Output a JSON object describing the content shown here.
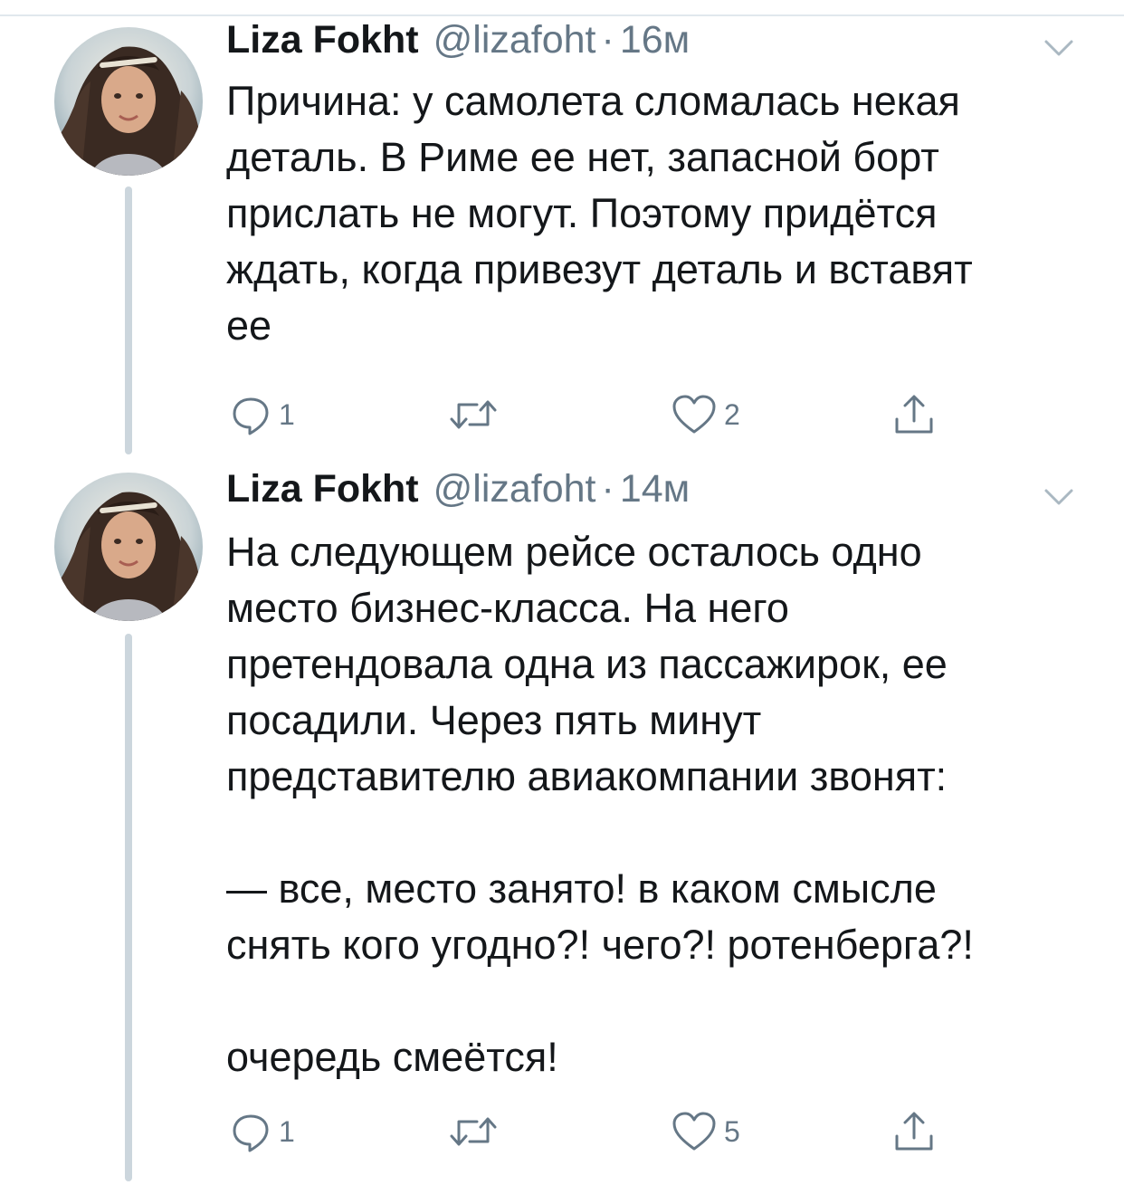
{
  "tweets": [
    {
      "author": {
        "name": "Liza Fokht",
        "handle": "@lizafoht",
        "avatar_icon": "profile-photo"
      },
      "separator": "·",
      "time": "16м",
      "text": "Причина: у самолета сломалась некая\nдеталь. В Риме ее нет, запасной борт\nприслать не могут. Поэтому придётся\nждать, когда привезут деталь и вставят\nее",
      "actions": {
        "reply_count": "1",
        "retweet_count": "",
        "like_count": "2"
      }
    },
    {
      "author": {
        "name": "Liza Fokht",
        "handle": "@lizafoht",
        "avatar_icon": "profile-photo"
      },
      "separator": "·",
      "time": "14м",
      "text": "На следующем рейсе осталось одно\nместо бизнес-класса. На него\nпретендовала одна из пассажирок, ее\nпосадили. Через пять минут\nпредставителю авиакомпании звонят:\n\n— все, место занято! в каком смысле\nснять кого угодно?! чего?! ротенберга?!\n\nочередь смеётся!",
      "actions": {
        "reply_count": "1",
        "retweet_count": "",
        "like_count": "5"
      }
    }
  ],
  "icons": {
    "reply": "reply-icon",
    "retweet": "retweet-icon",
    "like": "like-icon",
    "share": "share-icon",
    "menu": "chevron-down-icon"
  },
  "colors": {
    "text": "#14171a",
    "secondary": "#657786",
    "thread_line": "#ccd6dd",
    "divider": "#e1e8ed"
  }
}
